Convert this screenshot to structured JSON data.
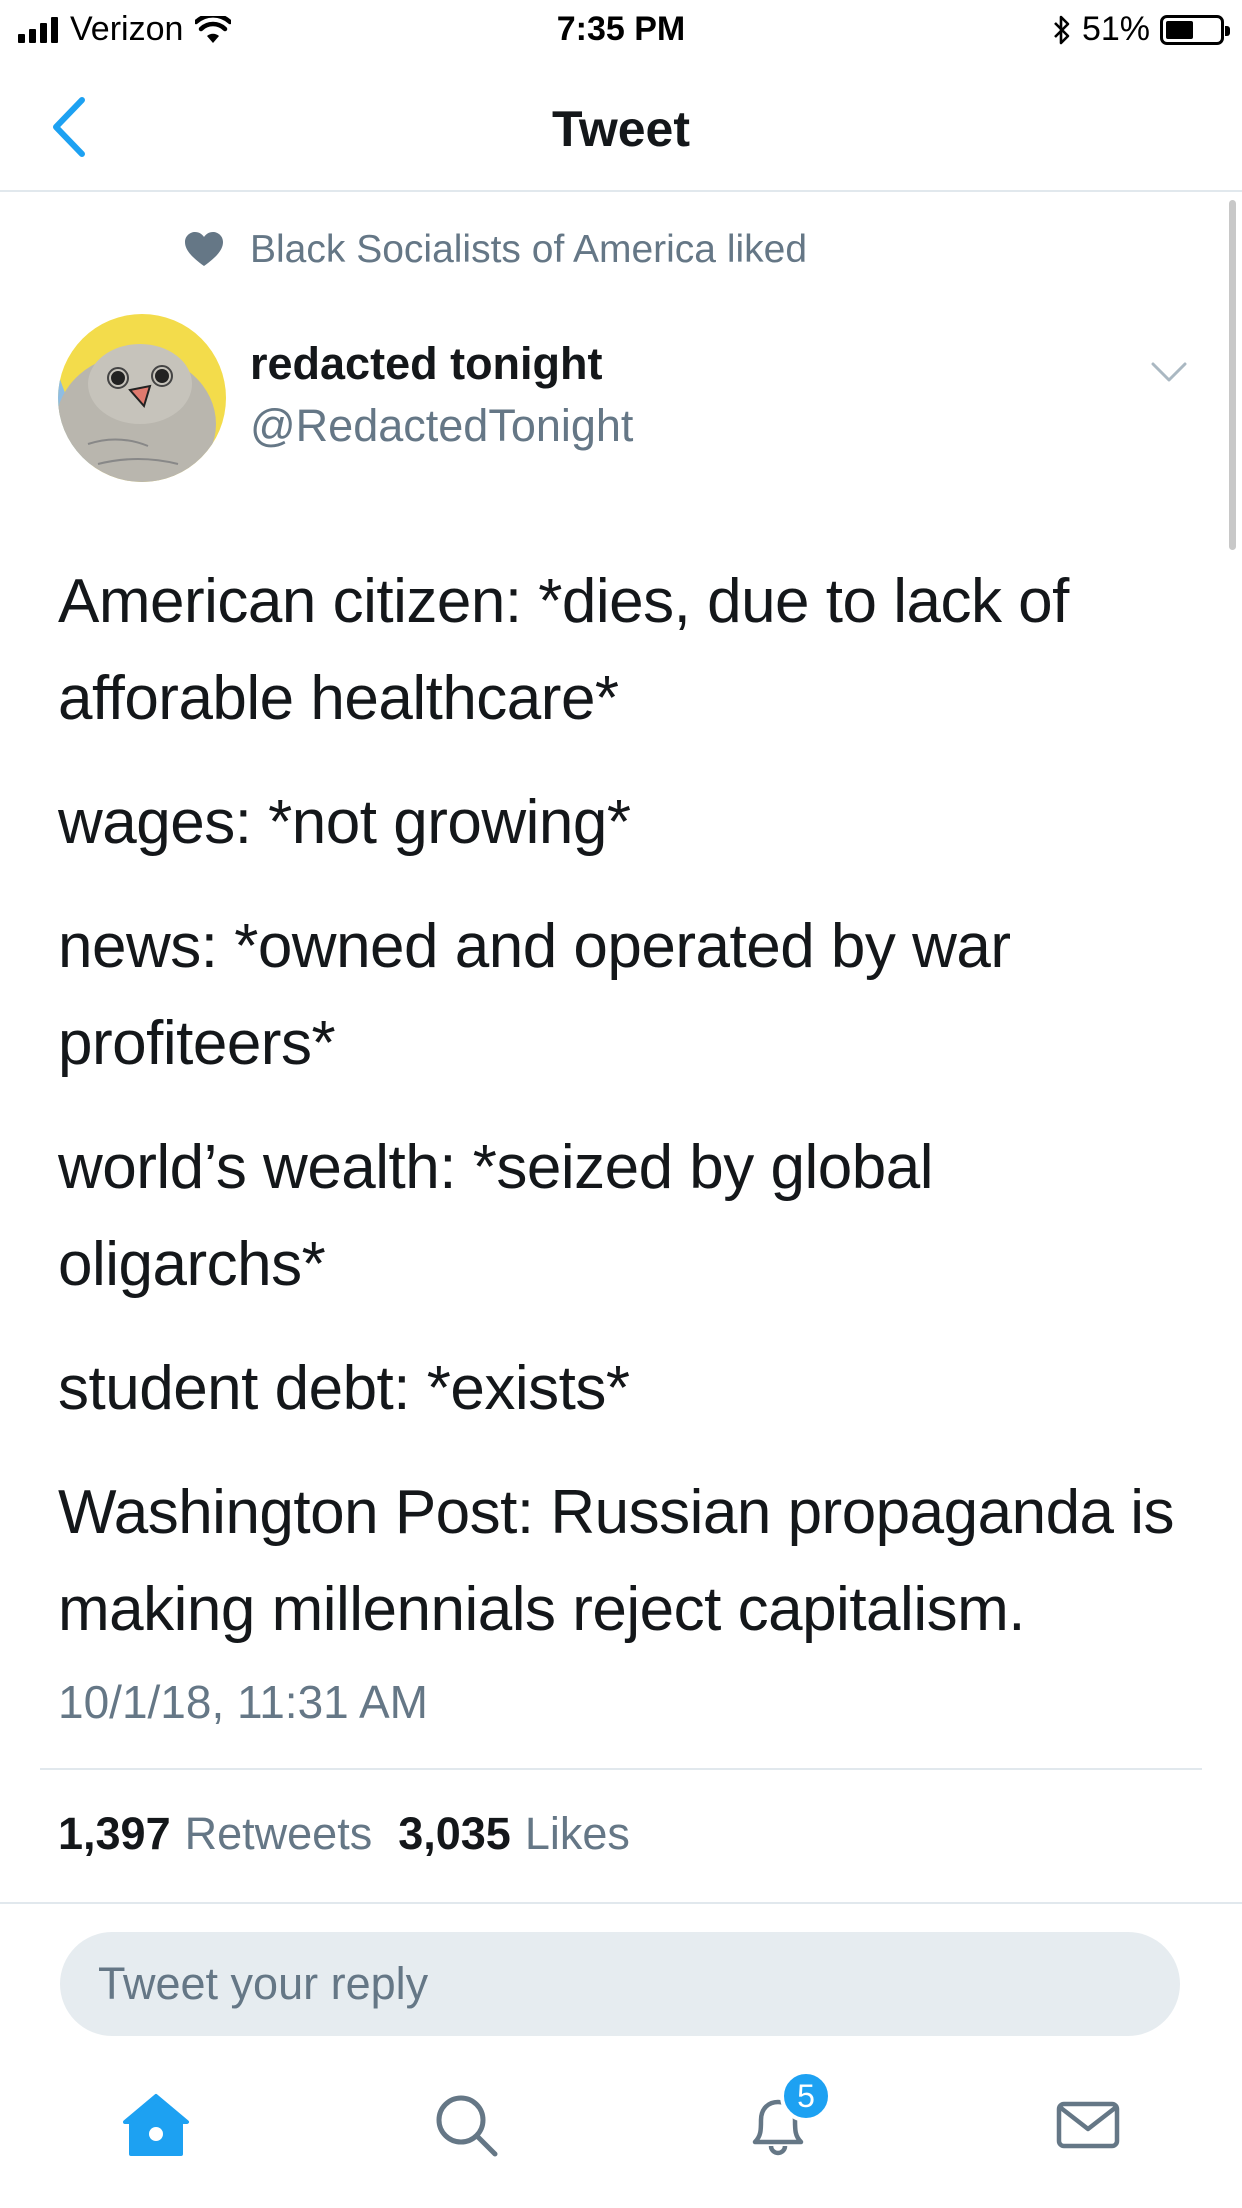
{
  "status_bar": {
    "carrier": "Verizon",
    "time": "7:35 PM",
    "battery": "51%",
    "battery_level": 0.51,
    "icons": [
      "signal-icon",
      "wifi-icon",
      "bluetooth-icon",
      "battery-icon"
    ]
  },
  "nav": {
    "title": "Tweet",
    "back_icon": "chevron-left-icon"
  },
  "tweet": {
    "social_context": "Black Socialists of America liked",
    "social_context_icon": "heart-icon",
    "author_name": "redacted tonight",
    "author_handle": "@RedactedTonight",
    "paragraphs": [
      "American citizen: *dies, due to lack of afforable healthcare*",
      "wages: *not growing*",
      "news: *owned and operated by war profiteers*",
      "world’s wealth: *seized by global oligarchs*",
      "student debt: *exists*",
      "Washington Post: Russian propaganda is making millennials reject capitalism."
    ],
    "timestamp": "10/1/18, 11:31 AM",
    "retweets_count": "1,397",
    "retweets_label": "Retweets",
    "likes_count": "3,035",
    "likes_label": "Likes"
  },
  "reply": {
    "placeholder": "Tweet your reply"
  },
  "tab_bar": {
    "tabs": [
      "home-icon",
      "search-icon",
      "notifications-icon",
      "messages-icon"
    ],
    "notifications_badge": "5"
  },
  "colors": {
    "accent": "#1da1f2",
    "secondary_text": "#657786",
    "primary_text": "#14171a",
    "divider": "#e1e8ed",
    "reply_bg": "#e6ecf0"
  }
}
